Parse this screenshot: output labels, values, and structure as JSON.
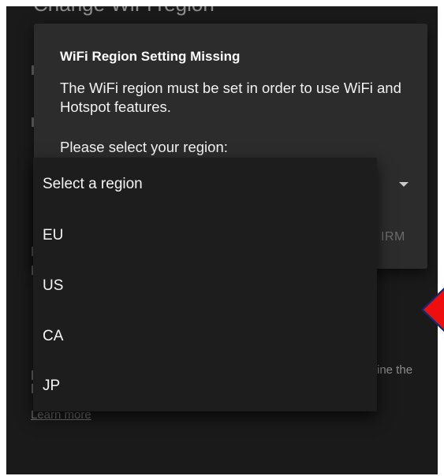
{
  "background": {
    "title": "Change WiFi region",
    "partial_text": "ine the",
    "learn_more": "Learn more"
  },
  "dialog": {
    "title": "WiFi Region Setting Missing",
    "message": "The WiFi region must be set in order to use WiFi and Hotspot features.",
    "prompt": "Please select your region:",
    "confirm_label": "CONFIRM",
    "confirm_visible": "IRM"
  },
  "dropdown": {
    "placeholder": "Select a region",
    "options": [
      "EU",
      "US",
      "CA",
      "JP"
    ]
  },
  "colors": {
    "screen_background": "#1a1a1a",
    "dialog_background": "#2c2c2c",
    "dropdown_background": "#1d1d1d",
    "handle_fill": "#ee0e0e",
    "handle_border": "#0b2a7a"
  },
  "icons": {
    "select_arrow": "dropdown-arrow-icon",
    "side_handle": "side-handle-icon"
  }
}
